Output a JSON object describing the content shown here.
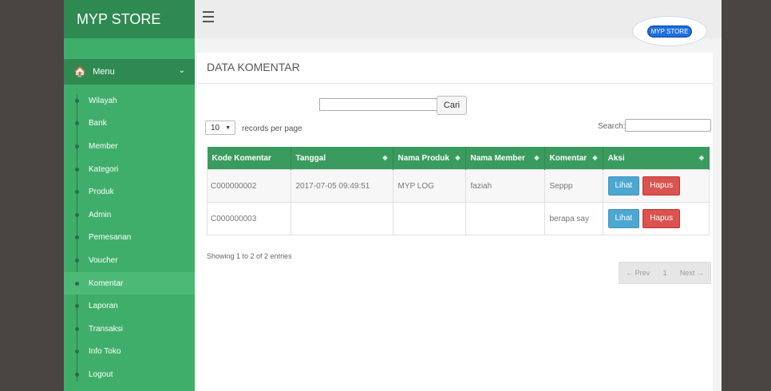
{
  "sidebar": {
    "brand": "MYP STORE",
    "menu_label": "Menu",
    "items": [
      {
        "label": "Wilayah"
      },
      {
        "label": "Bank"
      },
      {
        "label": "Member"
      },
      {
        "label": "Kategori"
      },
      {
        "label": "Produk"
      },
      {
        "label": "Admin"
      },
      {
        "label": "Pemesanan"
      },
      {
        "label": "Voucher"
      },
      {
        "label": "Komentar",
        "active": true
      },
      {
        "label": "Laporan"
      },
      {
        "label": "Transaksi"
      },
      {
        "label": "Info Toko"
      },
      {
        "label": "Logout"
      }
    ]
  },
  "topbar": {
    "logo_text": "MYP STORE"
  },
  "main": {
    "title": "DATA KOMENTAR",
    "search_button": "Cari",
    "per_page_value": "10",
    "per_page_label": "records per page",
    "search_label": "Search:",
    "table": {
      "headers": [
        "Kode Komentar",
        "Tanggal",
        "Nama Produk",
        "Nama Member",
        "Komentar",
        "Aksi"
      ],
      "rows": [
        {
          "kode": "C000000002",
          "tanggal": "2017-07-05 09:49:51",
          "produk": "MYP LOG",
          "member": "faziah",
          "komentar": "Seppp"
        },
        {
          "kode": "C000000003",
          "tanggal": "",
          "produk": "",
          "member": "",
          "komentar": "berapa say"
        }
      ],
      "action_view": "Lihat",
      "action_delete": "Hapus"
    },
    "info": "Showing 1 to 2 of 2 entries",
    "pager": {
      "prev": "← Prev",
      "page": "1",
      "next": "Next →"
    }
  },
  "colors": {
    "sidebar": "#3fae6a",
    "sidebar_dark": "#2f8a52",
    "table_header": "#3a9b5f",
    "btn_view": "#4ca7d1",
    "btn_delete": "#d9534f"
  }
}
